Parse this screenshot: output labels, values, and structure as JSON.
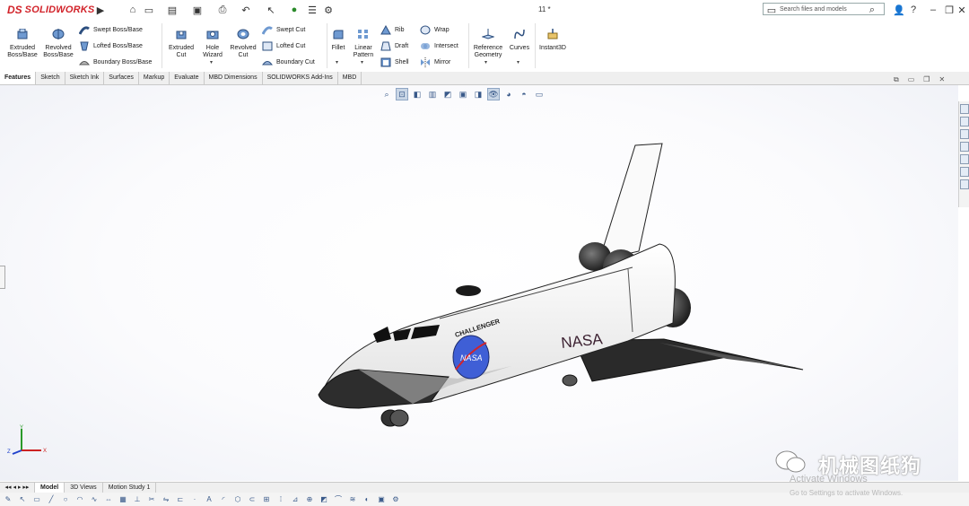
{
  "app": {
    "brand": "SOLIDWORKS",
    "logo_mark": "DS",
    "doc_title": "11 *"
  },
  "search": {
    "placeholder": "Search files and models"
  },
  "ribbon": {
    "extruded_boss": [
      "Extruded",
      "Boss/Base"
    ],
    "revolved_boss": [
      "Revolved",
      "Boss/Base"
    ],
    "swept_boss": "Swept Boss/Base",
    "lofted_boss": "Lofted Boss/Base",
    "boundary_boss": "Boundary Boss/Base",
    "extruded_cut": [
      "Extruded",
      "Cut"
    ],
    "hole_wizard": [
      "Hole",
      "Wizard"
    ],
    "revolved_cut": [
      "Revolved",
      "Cut"
    ],
    "swept_cut": "Swept Cut",
    "lofted_cut": "Lofted Cut",
    "boundary_cut": "Boundary Cut",
    "fillet": "Fillet",
    "linear_pattern": [
      "Linear",
      "Pattern"
    ],
    "rib": "Rib",
    "draft": "Draft",
    "shell": "Shell",
    "wrap": "Wrap",
    "intersect": "Intersect",
    "mirror": "Mirror",
    "reference_geometry": [
      "Reference",
      "Geometry"
    ],
    "curves": "Curves",
    "instant3d": "Instant3D"
  },
  "tabs": [
    "Features",
    "Sketch",
    "Sketch Ink",
    "Surfaces",
    "Markup",
    "Evaluate",
    "MBD Dimensions",
    "SOLIDWORKS Add-Ins",
    "MBD"
  ],
  "active_tab": "Features",
  "bottom_tabs": [
    "Model",
    "3D Views",
    "Motion Study 1"
  ],
  "active_bottom_tab": "Model",
  "model": {
    "label_nasa": "NASA",
    "label_challenger": "CHALLENGER",
    "logo_nasa": "NASA"
  },
  "triad": {
    "x": "X",
    "y": "Y",
    "z": "Z"
  },
  "watermark": "机械图纸狗",
  "windows_notice": {
    "title": "Activate Windows",
    "subtitle": "Go to Settings to activate Windows."
  },
  "colors": {
    "brand_red": "#d2232a",
    "nasa_blue": "#3f5fd6"
  }
}
